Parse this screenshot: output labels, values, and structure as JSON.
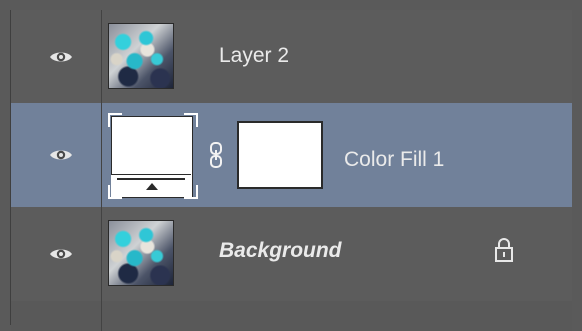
{
  "layers": [
    {
      "name": "Layer 2",
      "visible": true,
      "thumbnail": "photo",
      "selected": false,
      "locked": false
    },
    {
      "name": "Color Fill 1",
      "visible": true,
      "thumbnail": "color-fill",
      "selected": true,
      "locked": false,
      "mask": "white"
    },
    {
      "name": "Background",
      "visible": true,
      "thumbnail": "photo",
      "selected": false,
      "locked": true
    }
  ],
  "colors": {
    "panel_bg": "#5c5c5c",
    "selected_bg": "#71819a",
    "fill_color": "#ffffff",
    "text": "#eaeaea"
  },
  "icons": {
    "visibility": "eye-icon",
    "link": "chain-link-icon",
    "lock": "lock-icon"
  }
}
